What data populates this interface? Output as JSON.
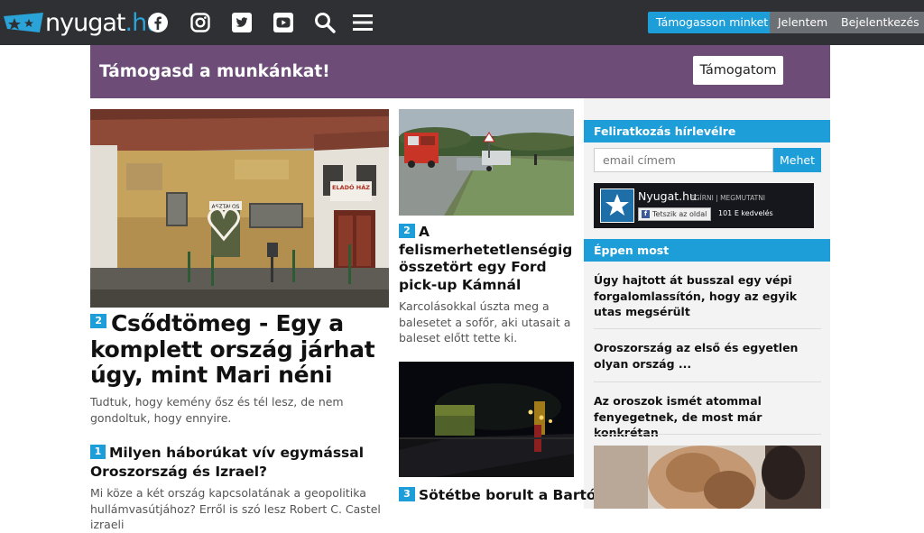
{
  "header": {
    "logo_text": "nyugat",
    "logo_tld": ".hu",
    "icons": [
      "facebook-icon",
      "instagram-icon",
      "twitter-icon",
      "youtube-icon",
      "search-icon",
      "menu-icon"
    ],
    "support_button": "Támogasson minket!",
    "report_button": "Jelentem",
    "login_button": "Bejelentkezés"
  },
  "banner": {
    "title": "Támogasd a munkánkat!",
    "button": "Támogatom"
  },
  "main_article": {
    "rank": "2",
    "title": "Csődtömeg - Egy a komplett ország járhat úgy, mint Mari néni",
    "lead": "Tudtuk, hogy kemény ősz és tél lesz, de nem gondoltuk, hogy ennyire.",
    "image_signs": [
      "ASZTALOS",
      "ELADÓ HÁZ"
    ]
  },
  "second_article": {
    "rank": "1",
    "title": "Milyen háborúkat vív egymással Oroszország és Izrael?",
    "lead": "Mi köze a két ország kapcsolatának a geopolitika hullámvasútjához? Erről is szó lesz Robert C. Castel izraeli"
  },
  "middle_articles": [
    {
      "rank": "2",
      "title": "A felismerhetetlenségig összetört egy Ford pick-up Kámnál",
      "lead": "Karcolásokkal úszta meg a balesetet a sofőr, aki utasait a baleset előtt tette ki."
    },
    {
      "rank": "3",
      "title": "Sötétbe borult a Bartók"
    }
  ],
  "sidebar": {
    "newsletter_title": "Feliratkozás hírlevélre",
    "email_placeholder": "email címem",
    "submit_button": "Mehet",
    "facebook": {
      "page_name": "Nyugat.hu",
      "tagline": "EGÍRNI | MEGMUTATNI",
      "like_button": "Tetszik az oldal",
      "likes": "101 E kedvelés"
    },
    "now_title": "Éppen most",
    "now_items": [
      "Úgy hajtott át busszal egy vépi forgalomlassítón, hogy az egyik utas megsérült",
      "Oroszország az első és egyetlen olyan ország ...",
      "Az oroszok ismét atommal fenyegetnek, de most már konkrétan"
    ]
  },
  "colors": {
    "topbar": "#2e3033",
    "accent": "#1e9ed8",
    "banner": "#6d4d78",
    "grey_button": "#6c6f73"
  }
}
